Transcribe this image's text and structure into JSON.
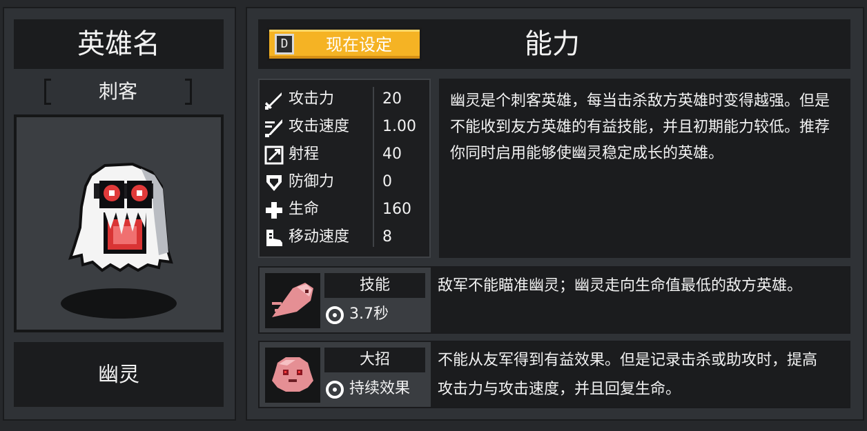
{
  "hero": {
    "name_header": "英雄名",
    "class_label": "刺客",
    "bracket_left": "[",
    "bracket_right": "]",
    "name": "幽灵"
  },
  "ability_panel": {
    "key_hint": "D",
    "set_button_label": "现在设定",
    "title": "能力",
    "stats": [
      {
        "icon": "sword-icon",
        "label": "攻击力",
        "value": "20"
      },
      {
        "icon": "attack-speed-icon",
        "label": "攻击速度",
        "value": "1.00"
      },
      {
        "icon": "range-icon",
        "label": "射程",
        "value": "40"
      },
      {
        "icon": "shield-icon",
        "label": "防御力",
        "value": "0"
      },
      {
        "icon": "plus-icon",
        "label": "生命",
        "value": "160"
      },
      {
        "icon": "boot-icon",
        "label": "移动速度",
        "value": "8"
      }
    ],
    "description": "幽灵是个刺客英雄，每当击杀敌方英雄时变得越强。但是不能收到友方英雄的有益技能，并且初期能力较低。推荐你同时启用能够使幽灵稳定成长的英雄。",
    "skill": {
      "title": "技能",
      "icon": "clock-icon",
      "cooldown": "3.7秒",
      "text": "敌军不能瞄准幽灵；幽灵走向生命值最低的敌方英雄。"
    },
    "ultimate": {
      "title": "大招",
      "icon": "clock-icon",
      "duration": "持续效果",
      "text": "不能从友军得到有益效果。但是记录击杀或助攻时，提高攻击力与攻击速度，并且回复生命。"
    }
  },
  "colors": {
    "background": "#26282b",
    "panel": "#2f3236",
    "dark_box": "#1b1c1e",
    "button_yellow": "#f5b324",
    "text": "#f2f2f2"
  }
}
